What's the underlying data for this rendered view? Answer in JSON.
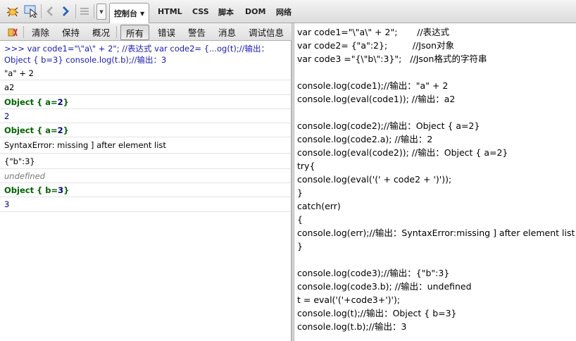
{
  "topbar": {
    "tabs": [
      "HTML",
      "CSS",
      "脚本",
      "DOM",
      "网络"
    ],
    "active_tab": "控制台",
    "icons": [
      "firebug-icon",
      "inspect-icon",
      "back-icon",
      "forward-icon",
      "list-icon",
      "dropdown-icon"
    ]
  },
  "toolbar": {
    "buttons": [
      "清除",
      "保持",
      "概况",
      "所有",
      "错误",
      "警告",
      "消息",
      "调试信息"
    ],
    "selected": "所有"
  },
  "console": {
    "command": ">>> var code1=\"\\\"a\\\" + 2\";      //表达式  var code2= {...og(t);//输出：Object { b=3} console.log(t.b);//输出：3",
    "rows": [
      {
        "kind": "text",
        "text": "\"a\" + 2"
      },
      {
        "kind": "text",
        "text": "a2"
      },
      {
        "kind": "obj",
        "prefix": "Object {  a=",
        "value": "2",
        "suffix": " }"
      },
      {
        "kind": "num",
        "text": "2"
      },
      {
        "kind": "obj",
        "prefix": "Object {  a=",
        "value": "2",
        "suffix": " }"
      },
      {
        "kind": "text",
        "text": "SyntaxError: missing ] after element list"
      },
      {
        "kind": "text",
        "text": "{\"b\":3}"
      },
      {
        "kind": "ital",
        "text": "undefined"
      },
      {
        "kind": "obj",
        "prefix": "Object {  b=",
        "value": "3",
        "suffix": " }"
      },
      {
        "kind": "num",
        "text": "3"
      }
    ]
  },
  "editor": {
    "lines": [
      "var code1=\"\\\"a\\\" + 2\";       //表达式",
      "var code2= {\"a\":2};         //Json对象",
      "var code3 =\"{\\\"b\\\":3}\";   //Json格式的字符串",
      "",
      "console.log(code1);//输出：\"a\" + 2",
      "console.log(eval(code1)); //输出：a2",
      "",
      "console.log(code2);//输出：Object { a=2}",
      "console.log(code2.a); //输出：2",
      "console.log(eval(code2)); //输出：Object { a=2}",
      "try{",
      "console.log(eval('(' + code2 + ')'));",
      "}",
      "catch(err)",
      "{",
      "console.log(err);//输出：SyntaxError:missing ] after element list",
      "}",
      "",
      "console.log(code3);//输出：{\"b\":3}",
      "console.log(code3.b); //输出：undefined",
      "t = eval('('+code3+')');",
      "console.log(t);//输出：Object { b=3}",
      "console.log(t.b);//输出：3"
    ]
  }
}
